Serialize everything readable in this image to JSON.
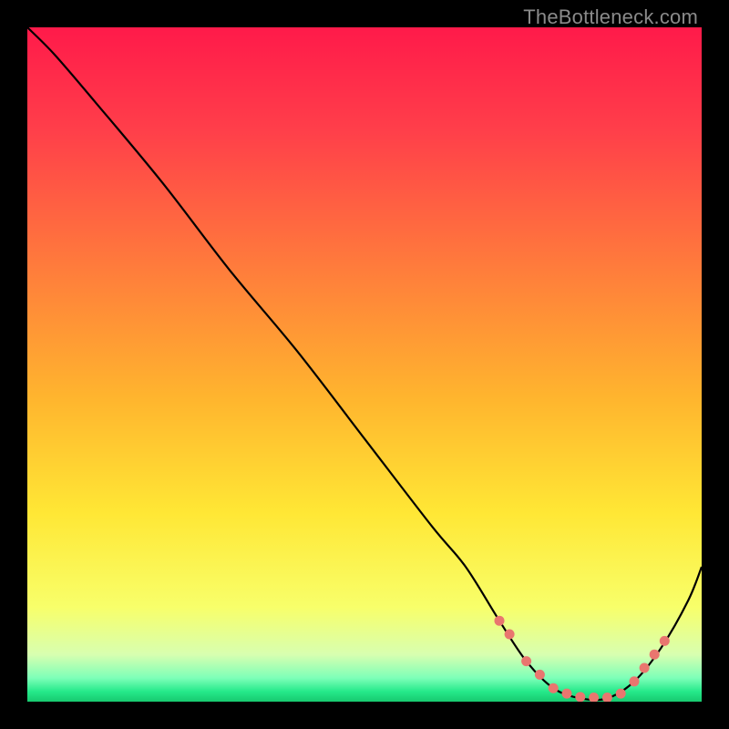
{
  "attribution": "TheBottleneck.com",
  "chart_data": {
    "type": "line",
    "title": "",
    "xlabel": "",
    "ylabel": "",
    "xlim": [
      0,
      100
    ],
    "ylim": [
      0,
      100
    ],
    "series": [
      {
        "name": "bottleneck-curve",
        "x": [
          0,
          4,
          10,
          20,
          30,
          40,
          50,
          60,
          65,
          70,
          74,
          78,
          82,
          86,
          90,
          94,
          98,
          100
        ],
        "y": [
          100,
          96,
          89,
          77,
          64,
          52,
          39,
          26,
          20,
          12,
          6,
          2,
          0.5,
          0.5,
          3,
          8,
          15,
          20
        ]
      }
    ],
    "markers": {
      "name": "highlight-dots",
      "x": [
        70,
        71.5,
        74,
        76,
        78,
        80,
        82,
        84,
        86,
        88,
        90,
        91.5,
        93,
        94.5
      ],
      "y": [
        12,
        10,
        6,
        4,
        2,
        1.2,
        0.7,
        0.6,
        0.6,
        1.2,
        3,
        5,
        7,
        9
      ]
    },
    "gradient_stops": [
      {
        "offset": 0.0,
        "color": "#ff1a4a"
      },
      {
        "offset": 0.15,
        "color": "#ff3e4a"
      },
      {
        "offset": 0.35,
        "color": "#ff7a3c"
      },
      {
        "offset": 0.55,
        "color": "#ffb52e"
      },
      {
        "offset": 0.72,
        "color": "#ffe735"
      },
      {
        "offset": 0.86,
        "color": "#f8ff6a"
      },
      {
        "offset": 0.93,
        "color": "#d8ffb0"
      },
      {
        "offset": 0.965,
        "color": "#7dffb8"
      },
      {
        "offset": 0.985,
        "color": "#25e98a"
      },
      {
        "offset": 1.0,
        "color": "#17c96f"
      }
    ],
    "marker_color": "#e9766f",
    "curve_color": "#000000"
  }
}
